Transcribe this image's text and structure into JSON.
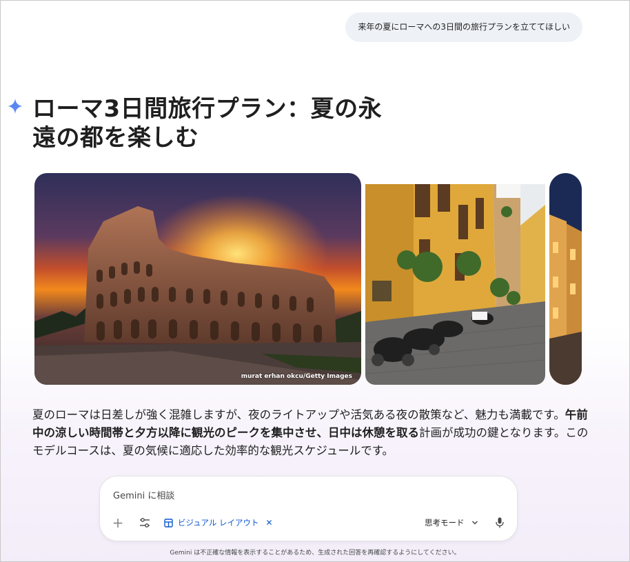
{
  "user_message": "来年の夏にローマへの3日間の旅行プランを立ててほしい",
  "response": {
    "title": "ローマ3日間旅行プラン：夏の永遠の都を楽しむ",
    "image_credit": "murat erhan okcu/Getty Images",
    "paragraph": {
      "part1": "夏のローマは日差しが強く混雑しますが、夜のライトアップや活気ある夜の散策など、魅力も満載です。",
      "bold": "午前中の涼しい時間帯と夕方以降に観光のピークを集中させ、日中は休憩を取る",
      "part2": "計画が成功の鍵となります。このモデルコースは、夏の気候に適応した効率的な観光スケジュールです。"
    }
  },
  "composer": {
    "placeholder": "Gemini に相談",
    "chip_label": "ビジュアル レイアウト",
    "chip_close": "✕",
    "mode_label": "思考モード"
  },
  "disclaimer": "Gemini は不正確な情報を表示することがあるため、生成された回答を再確認するようにしてください。",
  "icons": {
    "sparkle": "gemini-sparkle-icon",
    "plus": "plus-icon",
    "tools": "tools-icon",
    "layout": "layout-grid-icon",
    "mode_chevron": "chevron-down-icon",
    "mic": "microphone-icon"
  },
  "colors": {
    "accent_blue": "#0b57d0",
    "bubble_bg": "#eef1f5",
    "sparkle_blue": "#4285f4"
  }
}
